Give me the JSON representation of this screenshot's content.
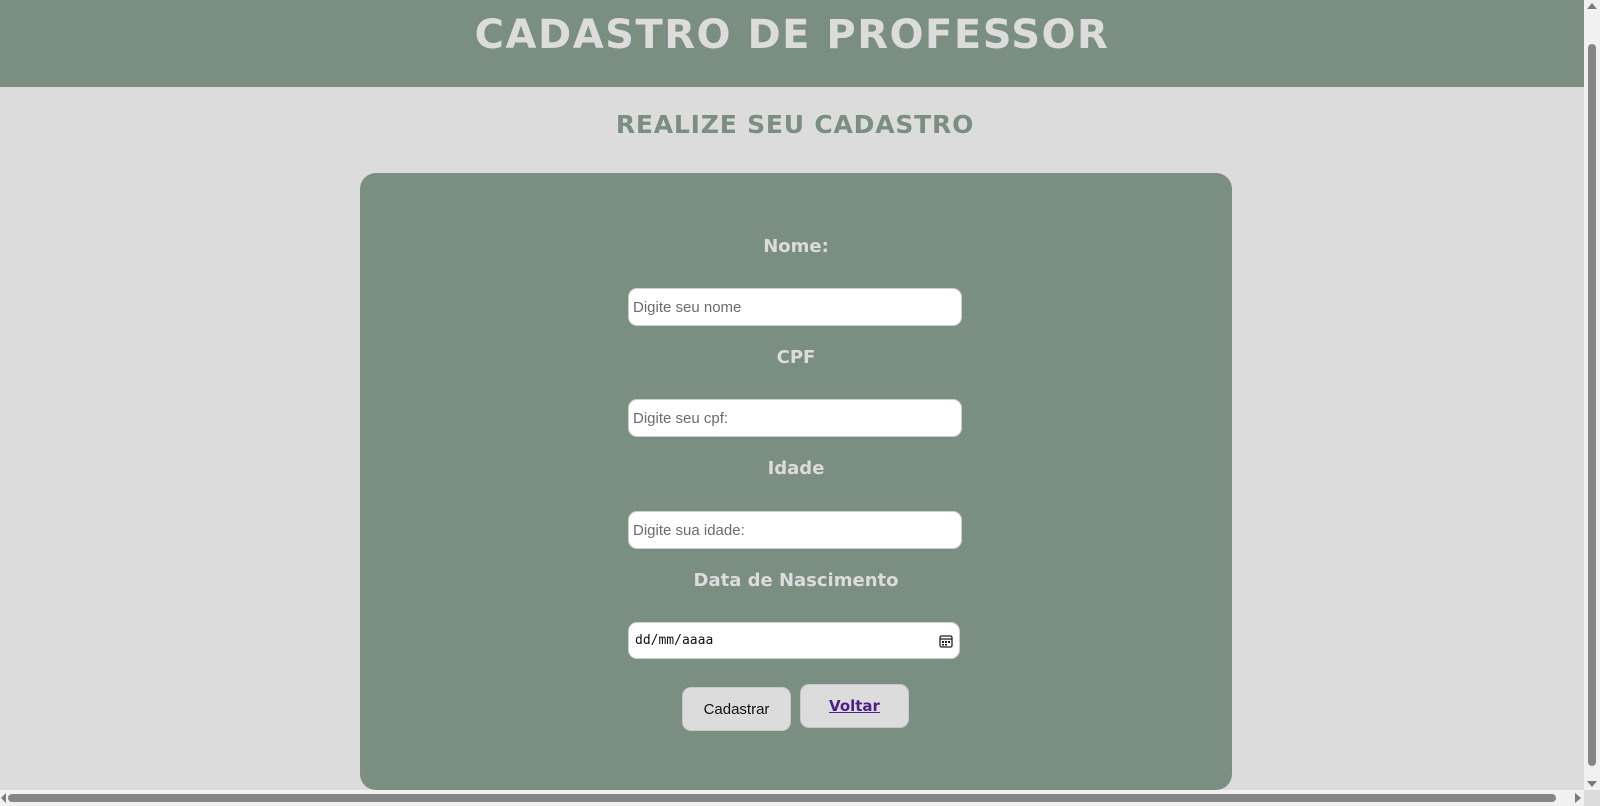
{
  "header": {
    "title": "CADASTRO DE PROFESSOR"
  },
  "subtitle": "REALIZE SEU CADASTRO",
  "form": {
    "nome": {
      "label": "Nome:",
      "placeholder": "Digite seu nome",
      "value": ""
    },
    "cpf": {
      "label": "CPF",
      "placeholder": "Digite seu cpf:",
      "value": ""
    },
    "idade": {
      "label": "Idade",
      "placeholder": "Digite sua idade:",
      "value": ""
    },
    "nascimento": {
      "label": "Data de Nascimento",
      "placeholder": "dd/mm/aaaa",
      "icon": "calendar-icon"
    },
    "submit_label": "Cadastrar",
    "back_label": "Voltar"
  },
  "colors": {
    "header_bg": "#7b8e82",
    "page_bg": "#dcdcdc",
    "card_bg": "#7b8e82",
    "label_text": "#dcdcdc",
    "link": "#4b1f86"
  }
}
